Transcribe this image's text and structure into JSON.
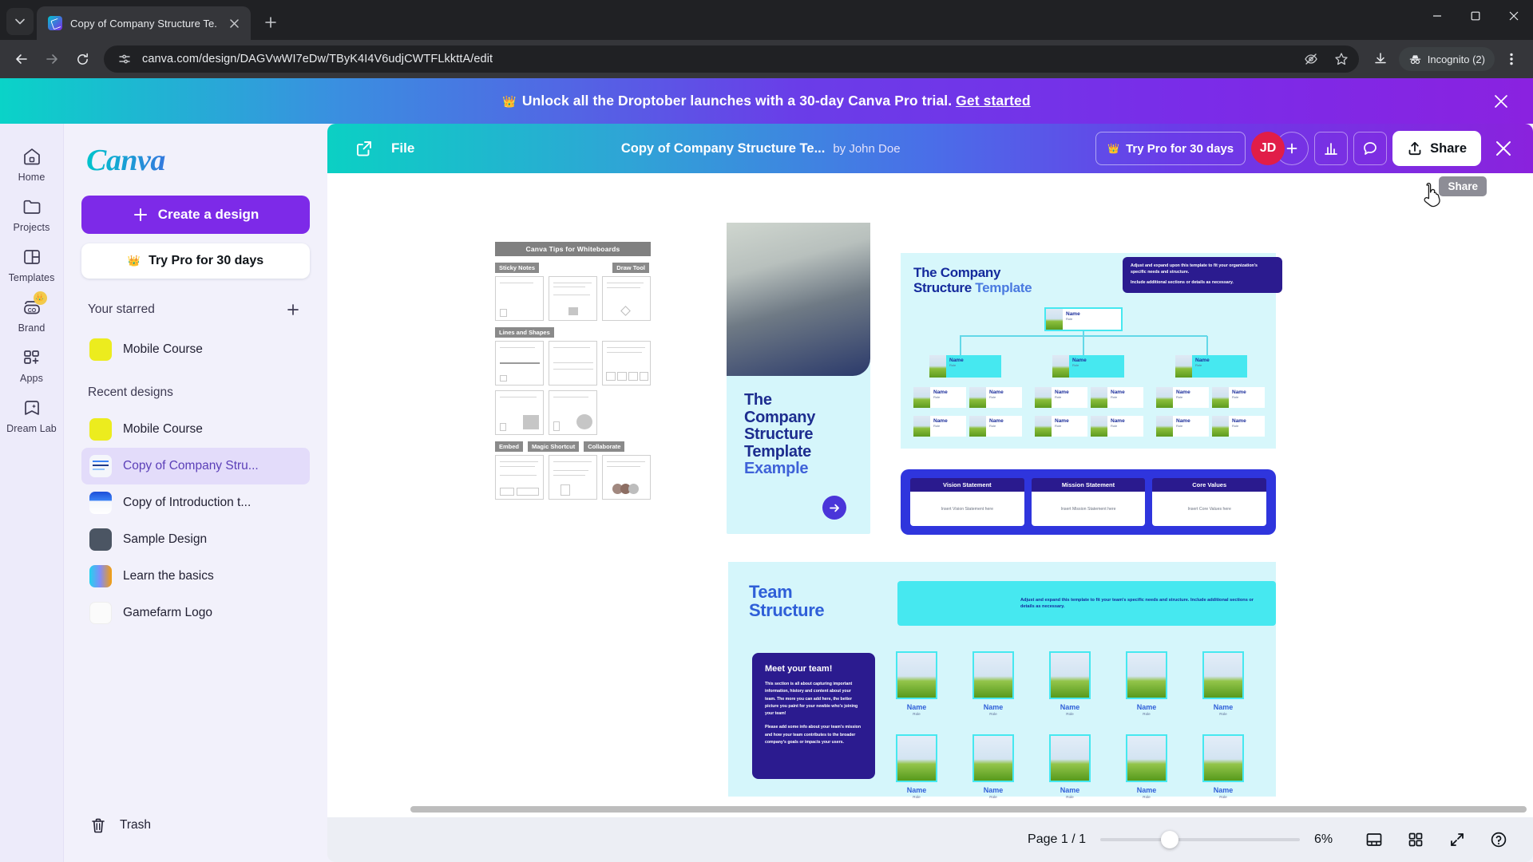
{
  "browser": {
    "tab": {
      "title": "Copy of Company Structure Te...",
      "favicon": "canva-icon"
    },
    "new_tab_label": "+",
    "url": "canva.com/design/DAGVwWI7eDw/TByK4I4V6udjCWTFLkkttA/edit",
    "profile_pill": "Incognito (2)",
    "icons": {
      "tab_list": "chevron-down-icon",
      "back": "back-arrow-icon",
      "forward": "forward-arrow-icon",
      "reload": "reload-icon",
      "site_info": "site-settings-icon",
      "third_party_cookies": "eye-slash-icon",
      "bookmark": "star-icon",
      "downloads": "download-icon",
      "incognito": "incognito-icon",
      "menu": "kebab-menu-icon",
      "minimize": "minimize-icon",
      "maximize": "maximize-icon",
      "close": "window-close-icon"
    }
  },
  "promo": {
    "crown": "crown-icon",
    "message": "Unlock all the Droptober launches with a 30-day Canva Pro trial.",
    "cta": "Get started",
    "close": "close-icon"
  },
  "rail": {
    "items": [
      {
        "label": "Home",
        "icon": "home-icon",
        "badge": ""
      },
      {
        "label": "Projects",
        "icon": "folder-icon",
        "badge": ""
      },
      {
        "label": "Templates",
        "icon": "templates-icon",
        "badge": ""
      },
      {
        "label": "Brand",
        "icon": "brand-co-icon",
        "badge": "crown-icon"
      },
      {
        "label": "Apps",
        "icon": "apps-grid-icon",
        "badge": ""
      },
      {
        "label": "Dream Lab",
        "icon": "dream-lab-icon",
        "badge": ""
      }
    ]
  },
  "sidebar": {
    "logo": "Canva",
    "create_button": "Create a design",
    "try_pro_button": "Try Pro for 30 days",
    "starred": {
      "title": "Your starred",
      "add_icon": "plus-icon",
      "items": [
        {
          "label": "Mobile Course",
          "thumb": "yellow"
        }
      ]
    },
    "recent": {
      "title": "Recent designs",
      "items": [
        {
          "label": "Mobile Course",
          "thumb": "yellow"
        },
        {
          "label": "Copy of Company Stru...",
          "thumb": "doc",
          "active": true
        },
        {
          "label": "Copy of Introduction t...",
          "thumb": "blue"
        },
        {
          "label": "Sample Design",
          "thumb": "dark"
        },
        {
          "label": "Learn the basics",
          "thumb": "mix"
        },
        {
          "label": "Gamefarm Logo",
          "thumb": "white"
        }
      ]
    },
    "trash": {
      "label": "Trash",
      "icon": "trash-icon"
    }
  },
  "editor": {
    "open_new_tab_icon": "open-external-icon",
    "file_menu": "File",
    "design_title": "Copy of Company Structure Te...",
    "author": "by John Doe",
    "try_pro": "Try Pro for 30 days",
    "try_pro_crown": "crown-icon",
    "avatar_initials": "JD",
    "avatar_color": "#e11d48",
    "add_collaborator_icon": "plus-icon",
    "insights_icon": "bar-chart-icon",
    "comments_icon": "comment-icon",
    "share_button": "Share",
    "share_icon": "upload-icon",
    "share_tooltip": "Share",
    "close_icon": "close-icon",
    "bottom": {
      "page_label": "Page 1 / 1",
      "zoom_percent": "6%",
      "fit_icon": "fit-page-icon",
      "grid_icon": "grid-view-icon",
      "expand_icon": "fullscreen-icon",
      "help_icon": "help-icon"
    }
  },
  "design": {
    "whiteboard": {
      "title": "Canva Tips for Whiteboards",
      "sections": [
        "Sticky Notes",
        "Draw Tool",
        "Lines and Shapes",
        "Embed",
        "Magic Shortcut",
        "Collaborate"
      ]
    },
    "cover": {
      "line1": "The",
      "line2": "Company",
      "line3": "Structure",
      "line4": "Template",
      "line5": "Example",
      "arrow_icon": "arrow-right-icon"
    },
    "org_chart": {
      "title_a": "The Company",
      "title_b": "Structure ",
      "title_c": "Template",
      "note_p1": "Adjust and expand upon this template to fit your organization's specific needs and structure.",
      "note_p2": "Include additional sections or details as necessary.",
      "node_name": "Name",
      "node_role": "Role"
    },
    "statements": [
      {
        "head": "Vision Statement",
        "body": "Insert Vision Statement here"
      },
      {
        "head": "Mission Statement",
        "body": "Insert Mission Statement here"
      },
      {
        "head": "Core Values",
        "body": "Insert Core Values here"
      }
    ],
    "team": {
      "title_a": "Team",
      "title_b": "Structure",
      "note": "Adjust and expand this template to fit your team's specific needs and structure. Include additional sections or details as necessary.",
      "meet_heading": "Meet your team!",
      "meet_p1": "This section is all about capturing important information, history and content about your team. The more you can add here, the better picture you paint for your newbie who's joining your team!",
      "meet_p2": "Please add some info about your team's mission and how your team contributes to the broader company's goals or impacts your users.",
      "member_name": "Name",
      "member_role": "Role"
    }
  },
  "colors": {
    "canva_purple": "#7d2ae8",
    "canva_teal": "#00c4cc",
    "avatar_red": "#e11d48",
    "template_navy": "#2b1b8f",
    "template_cyan": "#46e8f0"
  }
}
